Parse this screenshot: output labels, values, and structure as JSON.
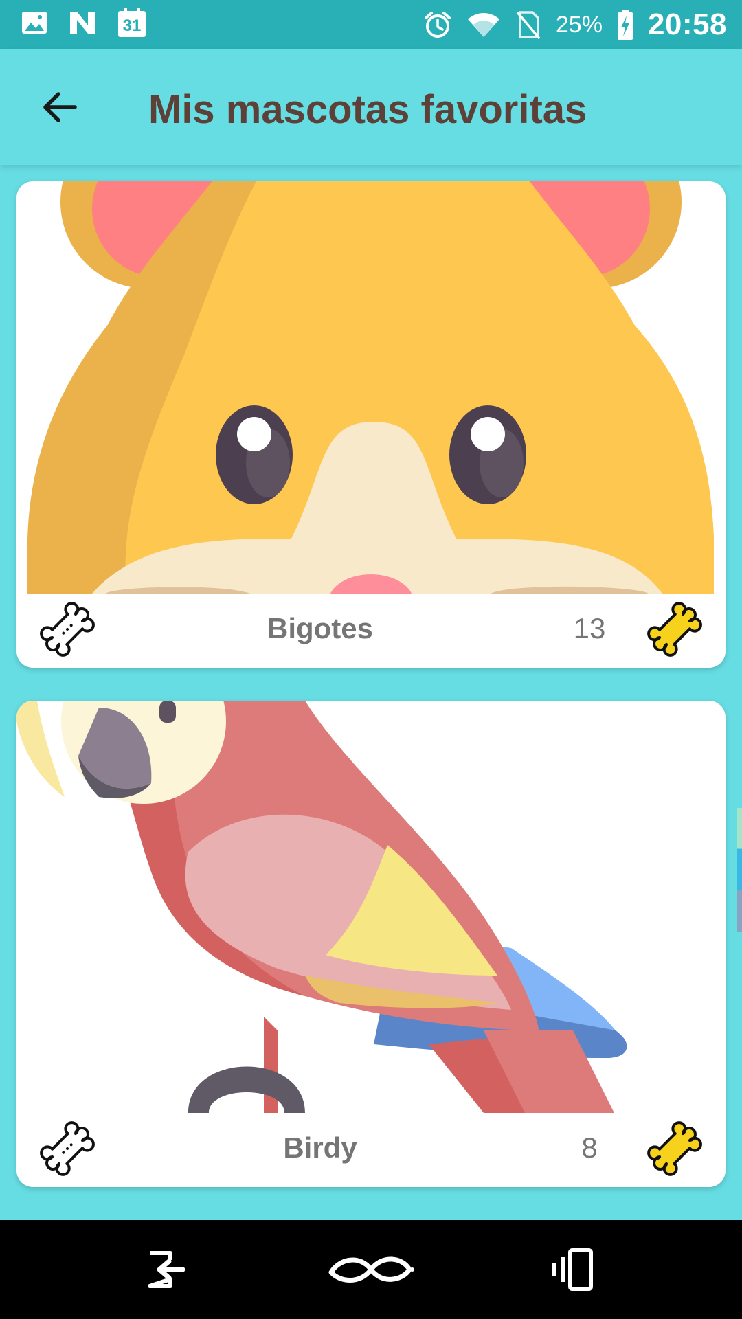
{
  "status_bar": {
    "battery_percent": "25%",
    "time": "20:58",
    "icons": [
      "image-icon",
      "n-notification-icon",
      "calendar-icon",
      "alarm-icon",
      "wifi-icon",
      "no-sim-icon",
      "battery-charging-icon"
    ],
    "calendar_day": "31"
  },
  "app_bar": {
    "title": "Mis mascotas favoritas",
    "back_icon": "arrow-back-icon"
  },
  "pets": [
    {
      "name": "Bigotes",
      "likes": "13",
      "image": "hamster"
    },
    {
      "name": "Birdy",
      "likes": "8",
      "image": "parrot"
    }
  ],
  "nav_bar": {
    "buttons": [
      "exit-icon",
      "infinity-knot-icon",
      "recents-icon"
    ]
  },
  "colors": {
    "status_bar": "#28b0b6",
    "app_bar": "#66dde3",
    "title": "#5d4037",
    "bone_filled": "#f7d21c",
    "text_grey": "#757575"
  }
}
